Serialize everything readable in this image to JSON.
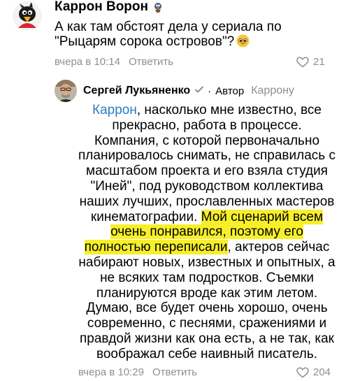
{
  "comment": {
    "author": "Каррон Ворон",
    "text_line1": "А как там обстоят дела у сериала по",
    "text_line2": "\"Рыцарям сорока островов\"?",
    "time": "вчера в 10:14",
    "reply_label": "Ответить",
    "likes": "21"
  },
  "reply": {
    "author": "Сергей Лукьяненко",
    "role": "Автор",
    "reply_to": "Каррону",
    "mention": "Каррон",
    "text_before_hl": ", насколько мне известно, все прекрасно, работа в процессе. Компания, с которой первоначально планировалось снимать, не справилась с масштабом проекта и его взяла студия \"Иней\", под руководством коллектива наших лучших, прославленных мастеров кинематографии.",
    "text_hl": "Мой сценарий всем очень понравился, поэтому его полностью переписали",
    "text_after_hl": ", актеров сейчас набирают новых, известных и опытных, а не всяких там подростков. Съемки планируются вроде как этим летом. Думаю, все будет очень хорошо, очень современно, с песнями, сражениями и правдой жизни как она есть, а не так, как воображал себе наивный писатель.",
    "time": "вчера в 10:29",
    "reply_label": "Ответить",
    "likes": "204"
  },
  "colors": {
    "link": "#2b7bc0",
    "meta": "#8a8f96",
    "highlight": "#f7ef2a"
  }
}
